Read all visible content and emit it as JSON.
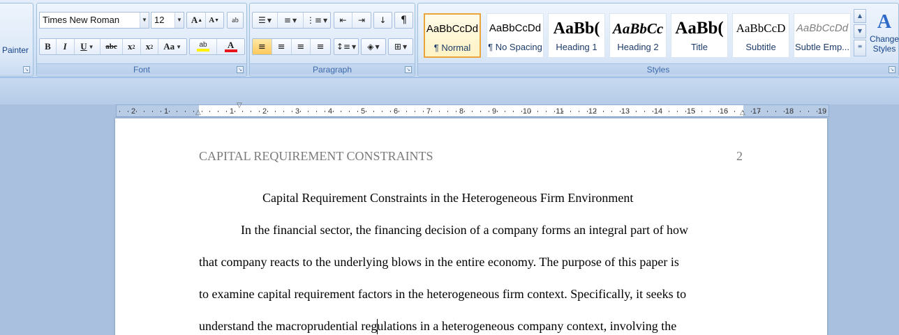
{
  "ribbon": {
    "clipboard": {
      "format_painter_label": "Painter"
    },
    "font": {
      "group_label": "Font",
      "font_name": "Times New Roman",
      "font_size": "12",
      "grow_label": "A",
      "shrink_label": "A",
      "clear_label": "ab",
      "bold_label": "B",
      "italic_label": "I",
      "underline_label": "U",
      "strikethrough_label": "abc",
      "subscript_label": "x",
      "subscript_mark": "2",
      "superscript_label": "x",
      "superscript_mark": "2",
      "case_label": "Aa",
      "highlight_label": "ab",
      "font_color_label": "A",
      "highlight_color": "#fff200",
      "font_color": "#e8161c"
    },
    "paragraph": {
      "group_label": "Paragraph"
    },
    "styles": {
      "group_label": "Styles",
      "items": [
        {
          "sample": "AaBbCcDd",
          "name": "¶ Normal"
        },
        {
          "sample": "AaBbCcDd",
          "name": "¶ No Spacing"
        },
        {
          "sample": "AaBb(",
          "name": "Heading 1"
        },
        {
          "sample": "AaBbCc",
          "name": "Heading 2"
        },
        {
          "sample": "AaBb(",
          "name": "Title"
        },
        {
          "sample": "AaBbCcD",
          "name": "Subtitle"
        },
        {
          "sample": "AaBbCcDd",
          "name": "Subtle Emp..."
        }
      ],
      "change_styles_line1": "Change",
      "change_styles_line2": "Styles"
    }
  },
  "ruler": {
    "left_numbers": [
      "2",
      "1"
    ],
    "right_numbers": [
      "1",
      "2",
      "3",
      "4",
      "5",
      "6",
      "7",
      "8",
      "9",
      "10",
      "11",
      "12",
      "13",
      "14",
      "15",
      "16",
      "17",
      "18",
      "19"
    ]
  },
  "document": {
    "header_title": "CAPITAL REQUIREMENT CONSTRAINTS",
    "page_number": "2",
    "title": "Capital Requirement Constraints in the Heterogeneous Firm Environment",
    "lines": [
      "In the financial sector, the financing decision of a company forms an integral part of how",
      "that company reacts to the underlying blows in the entire economy. The purpose of this paper is",
      "to examine capital requirement factors in the heterogeneous firm context. Specifically, it seeks to",
      "understand the macroprudential regulations in a heterogeneous company context, involving the"
    ]
  },
  "colors": {
    "ribbon_text": "#15428b",
    "selected_style_border": "#e9a53a"
  }
}
